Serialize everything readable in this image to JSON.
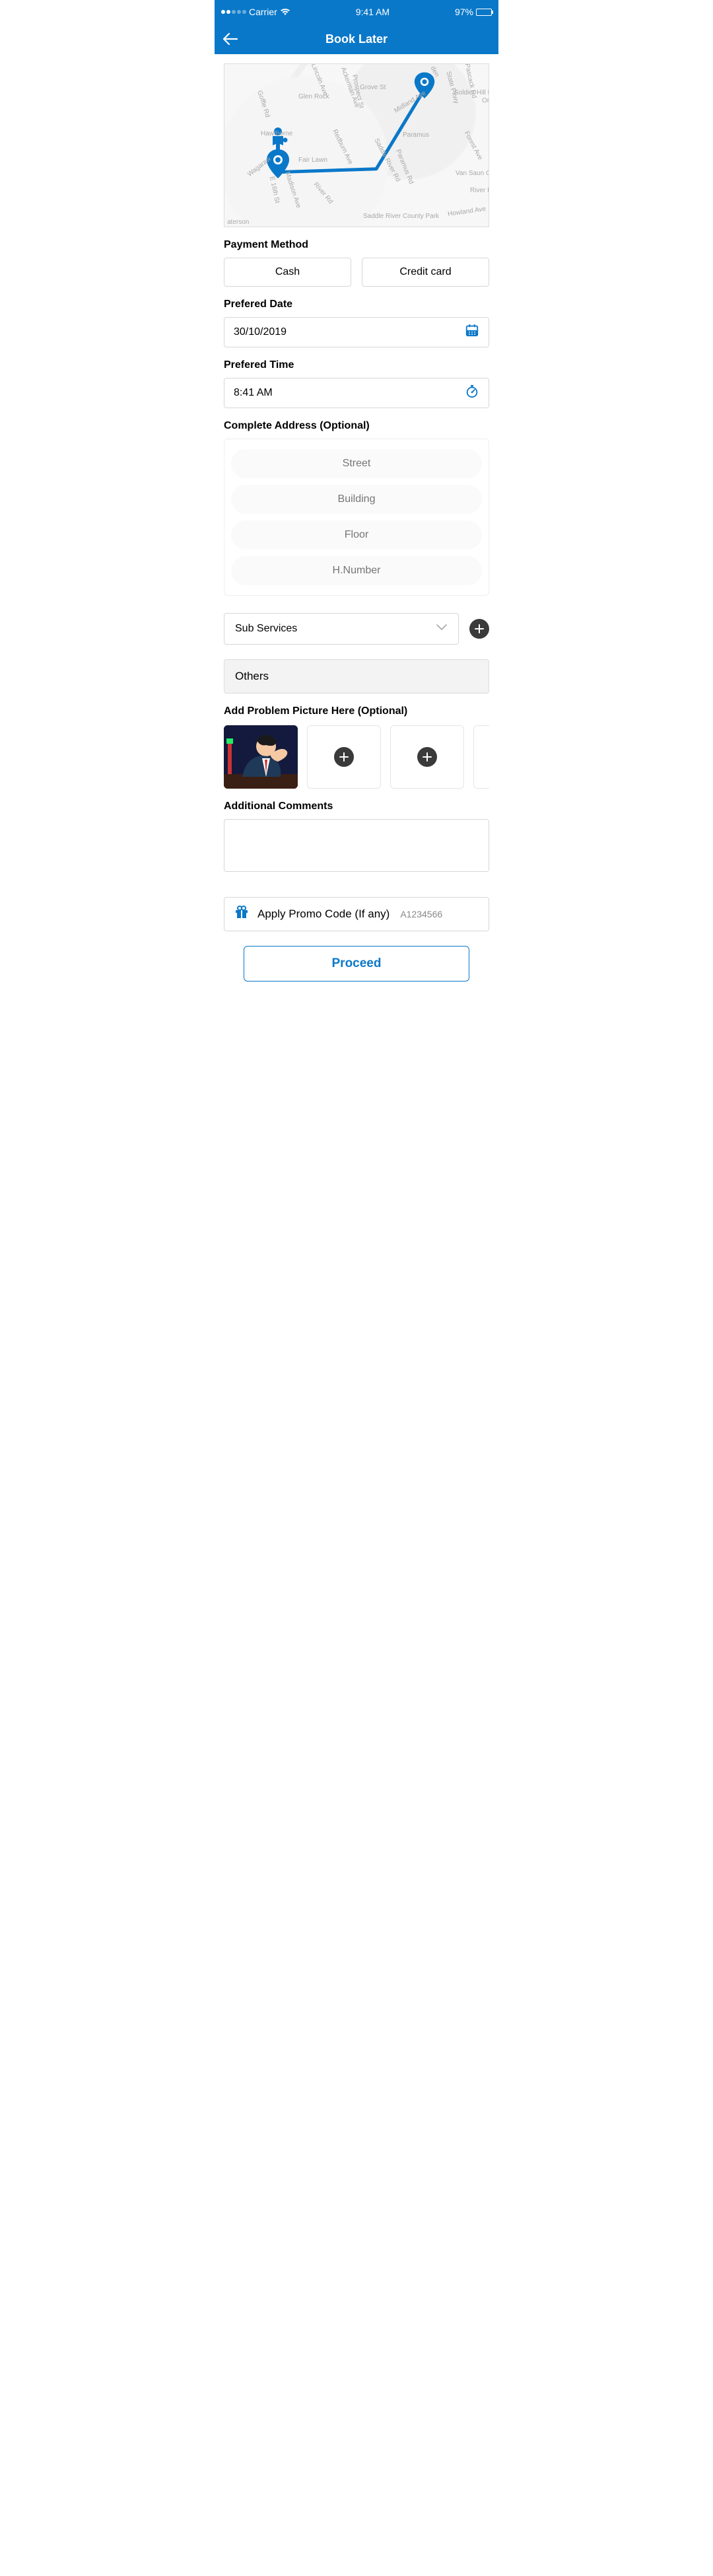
{
  "status": {
    "carrier": "Carrier",
    "time": "9:41 AM",
    "battery_pct": "97%"
  },
  "nav": {
    "title": "Book Later"
  },
  "map": {
    "labels": [
      "Glen Rock",
      "Ackerman Ave",
      "Grove St",
      "Midland Ave",
      "State Pkwy",
      "Soldier Hill Rd",
      "Ora",
      "Hawthorne",
      "Fair Lawn",
      "Paramus",
      "Forest Ave",
      "Van Saun County Par",
      "River B",
      "Saddle River County Park",
      "Howland Ave",
      "aterson",
      "Lincoln Ave",
      "Prospect St",
      "Goffle Rd",
      "Wagaraw",
      "Redburn Ave",
      "Pascack Rd",
      "Saddle River Rd",
      "Paramus Rd",
      "E 16th St",
      "Madison Ave",
      "River Rd",
      "den"
    ]
  },
  "sections": {
    "payment": "Payment Method",
    "date": "Prefered Date",
    "time": "Prefered Time",
    "address": "Complete Address (Optional)",
    "pictures": "Add Problem Picture Here (Optional)",
    "comments": "Additional Comments"
  },
  "payment": {
    "cash": "Cash",
    "card": "Credit card"
  },
  "date": {
    "value": "30/10/2019"
  },
  "time": {
    "value": "8:41 AM"
  },
  "address": {
    "street": "Street",
    "building": "Building",
    "floor": "Floor",
    "house": "H.Number"
  },
  "subservices": {
    "label": "Sub Services"
  },
  "others": {
    "label": "Others"
  },
  "promo": {
    "label": "Apply Promo Code (If any)",
    "code": "A1234566"
  },
  "proceed": {
    "label": "Proceed"
  }
}
